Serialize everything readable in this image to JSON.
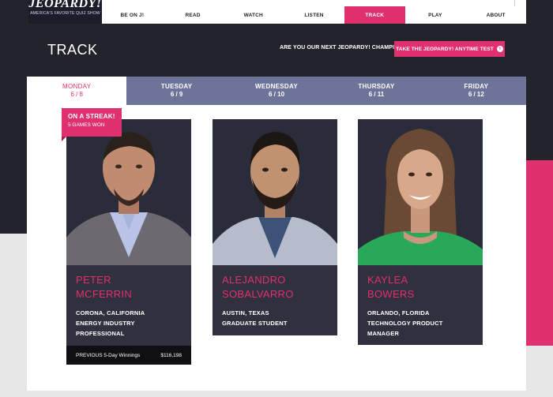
{
  "logo": {
    "wordmark": "JEOPARDY!",
    "tagline": "AMERICA'S FAVORITE QUIZ SHOW"
  },
  "nav": {
    "items": [
      {
        "label": "BE ON J!"
      },
      {
        "label": "READ"
      },
      {
        "label": "WATCH"
      },
      {
        "label": "LISTEN"
      },
      {
        "label": "TRACK",
        "active": true
      },
      {
        "label": "PLAY"
      },
      {
        "label": "ABOUT"
      }
    ]
  },
  "header": {
    "title": "TRACK",
    "champion_question": "ARE YOU OUR NEXT JEOPARDY! CHAMPION?",
    "test_button": "TAKE THE JEOPARDY! ANYTIME TEST"
  },
  "days": [
    {
      "day": "MONDAY",
      "date": "6 / 8",
      "active": true
    },
    {
      "day": "TUESDAY",
      "date": "6 / 9"
    },
    {
      "day": "WEDNESDAY",
      "date": "6 / 10"
    },
    {
      "day": "THURSDAY",
      "date": "6 / 11"
    },
    {
      "day": "FRIDAY",
      "date": "6 / 12"
    }
  ],
  "streak_badge": {
    "title": "ON A STREAK!",
    "subtitle": "5 GAMES WON"
  },
  "contestants": [
    {
      "first": "PETER",
      "last": "McFERRIN",
      "location": "CORONA, CALIFORNIA",
      "occupation_1": "ENERGY INDUSTRY",
      "occupation_2": "PROFESSIONAL",
      "winnings_label": "PREVIOUS 5-Day Winnings",
      "winnings_value": "$116,198"
    },
    {
      "first": "ALEJANDRO",
      "last": "SOBALVARRO",
      "location": "AUSTIN, TEXAS",
      "occupation_1": "GRADUATE STUDENT"
    },
    {
      "first": "KAYLEA",
      "last": "BOWERS",
      "location": "ORLANDO, FLORIDA",
      "occupation_1": "TECHNOLOGY PRODUCT",
      "occupation_2": "MANAGER"
    }
  ],
  "colors": {
    "accent": "#e0306e",
    "tab": "#6e739a",
    "card": "#30303e",
    "band": "#23232b"
  },
  "icons": {
    "test_button": "arrow-circle-right-icon"
  }
}
